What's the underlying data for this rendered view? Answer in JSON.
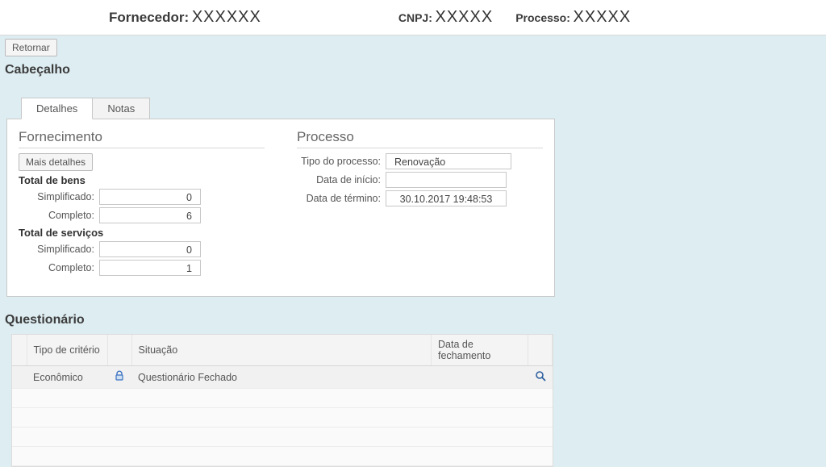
{
  "header": {
    "fornecedor_label": "Fornecedor:",
    "fornecedor_value": "XXXXXX",
    "cnpj_label": "CNPJ:",
    "cnpj_value": "XXXXX",
    "processo_label": "Processo:",
    "processo_value": "XXXXX"
  },
  "toolbar": {
    "retornar": "Retornar"
  },
  "sections": {
    "cabecalho": "Cabeçalho",
    "questionario": "Questionário"
  },
  "tabs": {
    "detalhes": "Detalhes",
    "notas": "Notas"
  },
  "fornecimento": {
    "title": "Fornecimento",
    "mais_detalhes": "Mais detalhes",
    "total_bens": "Total de bens",
    "total_servicos": "Total de serviços",
    "simplificado_label": "Simplificado:",
    "completo_label": "Completo:",
    "bens_simpl": "0",
    "bens_compl": "6",
    "serv_simpl": "0",
    "serv_compl": "1"
  },
  "processo": {
    "title": "Processo",
    "tipo_label": "Tipo do processo:",
    "tipo_value": "Renovação",
    "inicio_label": "Data de início:",
    "inicio_value": "",
    "termino_label": "Data de término:",
    "termino_value": "30.10.2017 19:48:53"
  },
  "questionario": {
    "cols": {
      "blank": "",
      "tipo": "Tipo de critério",
      "icon": "",
      "situacao": "Situação",
      "fechamento": "Data de fechamento",
      "action": ""
    },
    "rows": [
      {
        "tipo": "Econômico",
        "situacao": "Questionário Fechado",
        "fechamento": ""
      }
    ]
  }
}
